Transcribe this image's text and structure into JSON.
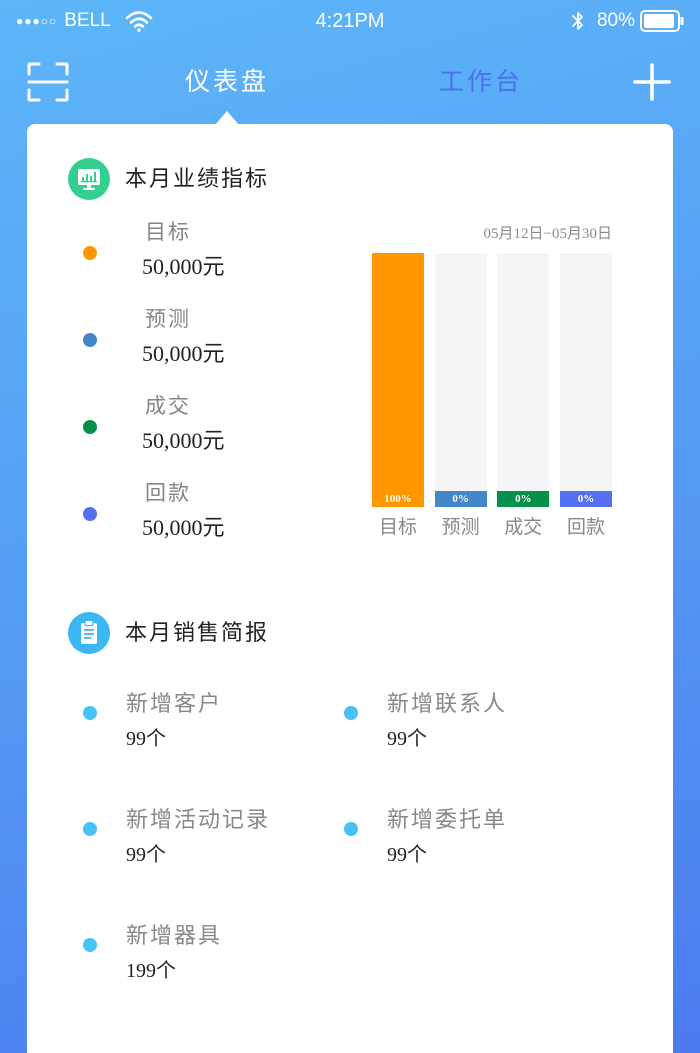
{
  "status_bar": {
    "signal": "●●●○○",
    "carrier": "BELL",
    "time": "4:21PM",
    "battery": "80%",
    "icons": [
      "wifi-icon",
      "bluetooth-icon",
      "battery-icon"
    ]
  },
  "header": {
    "scan_icon": "scan-icon",
    "add_icon": "plus-icon",
    "tabs": [
      {
        "label": "仪表盘",
        "active": true
      },
      {
        "label": "工作台",
        "active": false
      }
    ],
    "active_color": "#ffffff",
    "inactive_color": "#4a6ff0"
  },
  "performance": {
    "title": "本月业绩指标",
    "icon": "monitor-chart-icon",
    "icon_color": "#34cf8e",
    "date_range": "05月12日−05月30日",
    "legend": [
      {
        "label": "目标",
        "value": "50,000元",
        "color": "#ff9600"
      },
      {
        "label": "预测",
        "value": "50,000元",
        "color": "#4387c8"
      },
      {
        "label": "成交",
        "value": "50,000元",
        "color": "#06914a"
      },
      {
        "label": "回款",
        "value": "50,000元",
        "color": "#5571f1"
      }
    ]
  },
  "chart_data": {
    "type": "bar",
    "categories": [
      "目标",
      "预测",
      "成交",
      "回款"
    ],
    "values": [
      100,
      0,
      0,
      0
    ],
    "data_labels": [
      "100%",
      "0%",
      "0%",
      "0%"
    ],
    "colors": [
      "#ff9600",
      "#4387c8",
      "#06914a",
      "#5571f1"
    ],
    "track_color": "#f5f5f5",
    "ylim": [
      0,
      100
    ],
    "grid": false,
    "legend": "left"
  },
  "sales_brief": {
    "title": "本月销售简报",
    "icon": "clipboard-icon",
    "icon_color": "#3bb8f2",
    "bullet_color": "#47c2f6",
    "items": [
      {
        "label": "新增客户",
        "value": "99个"
      },
      {
        "label": "新增联系人",
        "value": "99个"
      },
      {
        "label": "新增活动记录",
        "value": "99个"
      },
      {
        "label": "新增委托单",
        "value": "99个"
      },
      {
        "label": "新增器具",
        "value": "199个"
      }
    ]
  }
}
